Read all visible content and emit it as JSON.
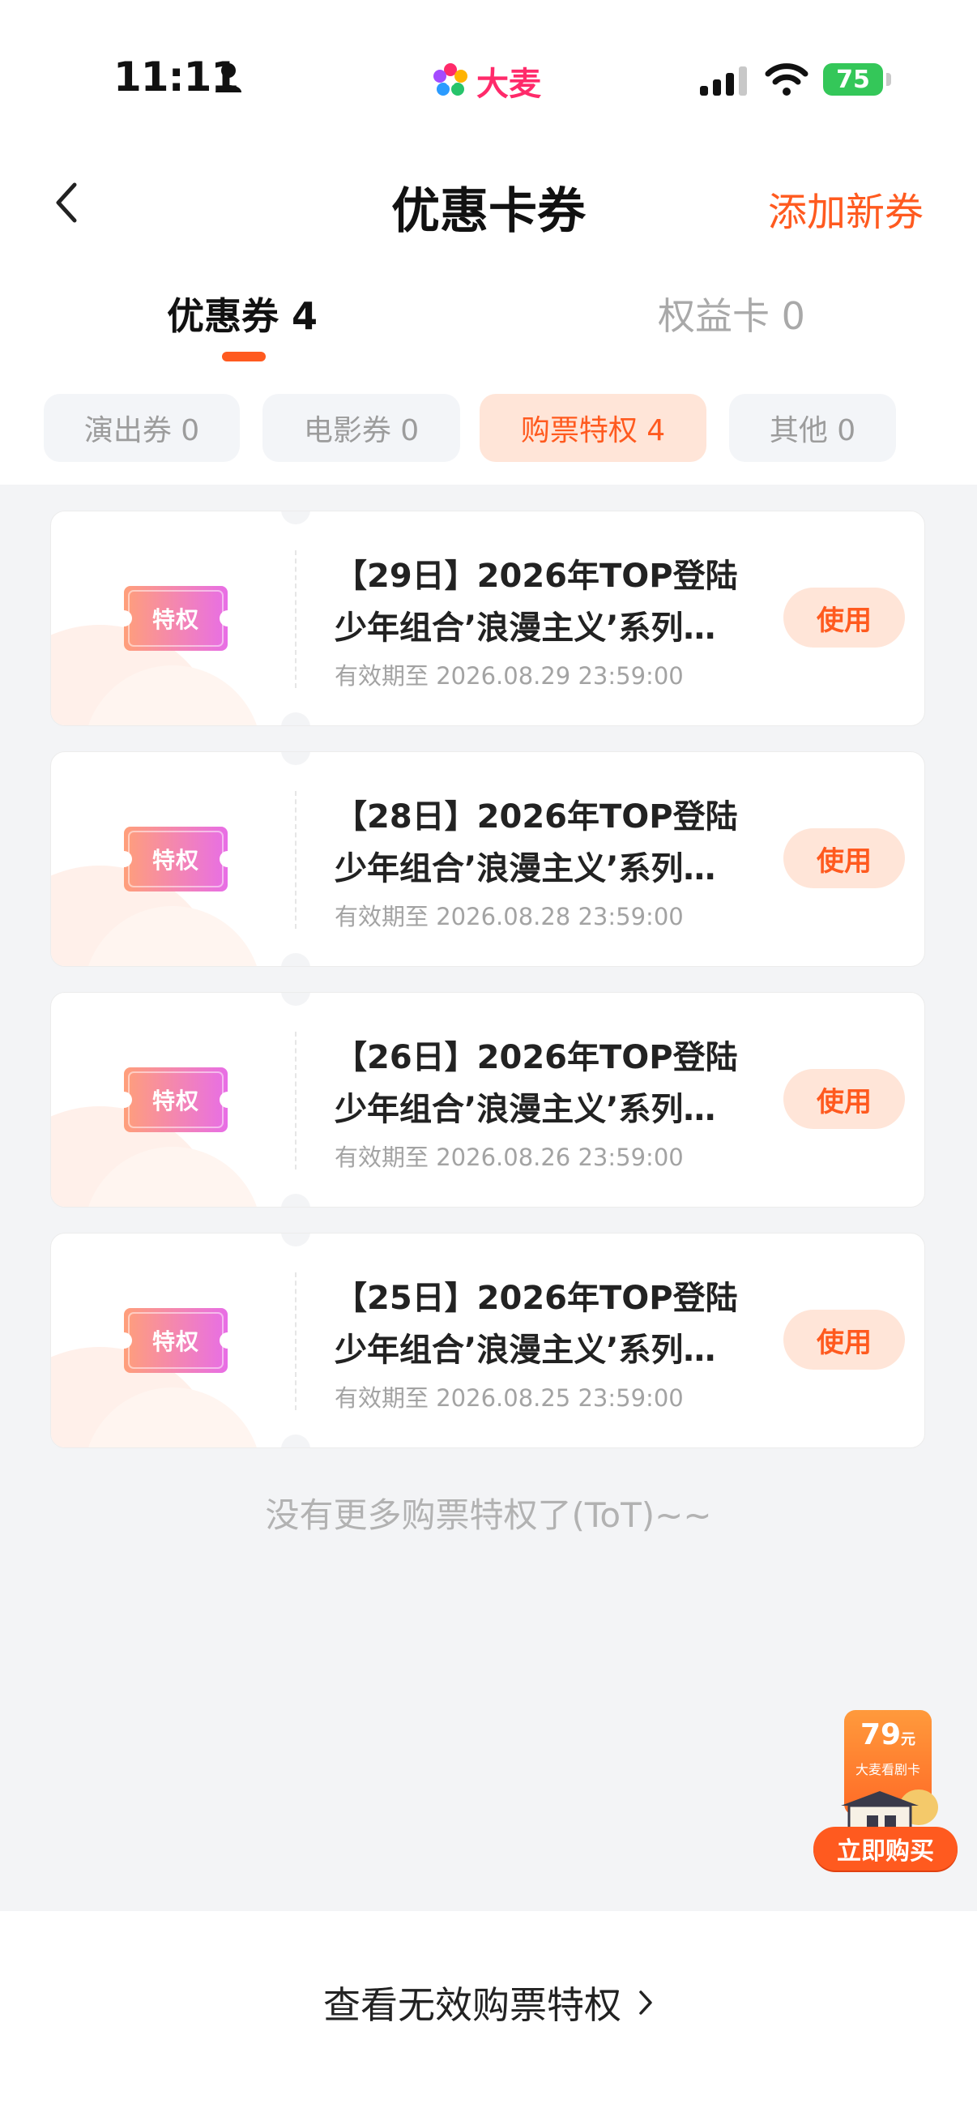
{
  "status_bar": {
    "time": "11:11",
    "battery": "75"
  },
  "brand": {
    "name": "大麦"
  },
  "nav": {
    "title": "优惠卡券",
    "action": "添加新券"
  },
  "main_tabs": [
    {
      "label": "优惠券 4",
      "active": true
    },
    {
      "label": "权益卡 0",
      "active": false
    }
  ],
  "filter_chips": [
    {
      "label": "演出券 0",
      "active": false
    },
    {
      "label": "电影券 0",
      "active": false
    },
    {
      "label": "购票特权 4",
      "active": true
    },
    {
      "label": "其他 0",
      "active": false
    }
  ],
  "coupons": [
    {
      "badge": "特权",
      "title_line1": "【29日】2026年TOP登陆",
      "title_line2": "少年组合’浪漫主义’系列…",
      "expiry": "有效期至 2026.08.29 23:59:00",
      "button": "使用"
    },
    {
      "badge": "特权",
      "title_line1": "【28日】2026年TOP登陆",
      "title_line2": "少年组合’浪漫主义’系列…",
      "expiry": "有效期至 2026.08.28 23:59:00",
      "button": "使用"
    },
    {
      "badge": "特权",
      "title_line1": "【26日】2026年TOP登陆",
      "title_line2": "少年组合’浪漫主义’系列…",
      "expiry": "有效期至 2026.08.26 23:59:00",
      "button": "使用"
    },
    {
      "badge": "特权",
      "title_line1": "【25日】2026年TOP登陆",
      "title_line2": "少年组合’浪漫主义’系列…",
      "expiry": "有效期至 2026.08.25 23:59:00",
      "button": "使用"
    }
  ],
  "end_note": "没有更多购票特权了(ToT)~~",
  "promo": {
    "price": "79",
    "unit": "元",
    "subtitle": "大麦看剧卡",
    "button": "立即购买"
  },
  "bottom_link": {
    "label": "查看无效购票特权"
  },
  "colors": {
    "accent": "#ff5a1f",
    "chip_active_bg": "#ffe5d8",
    "brand_pink": "#ff2a6a",
    "battery_green": "#34c759"
  }
}
